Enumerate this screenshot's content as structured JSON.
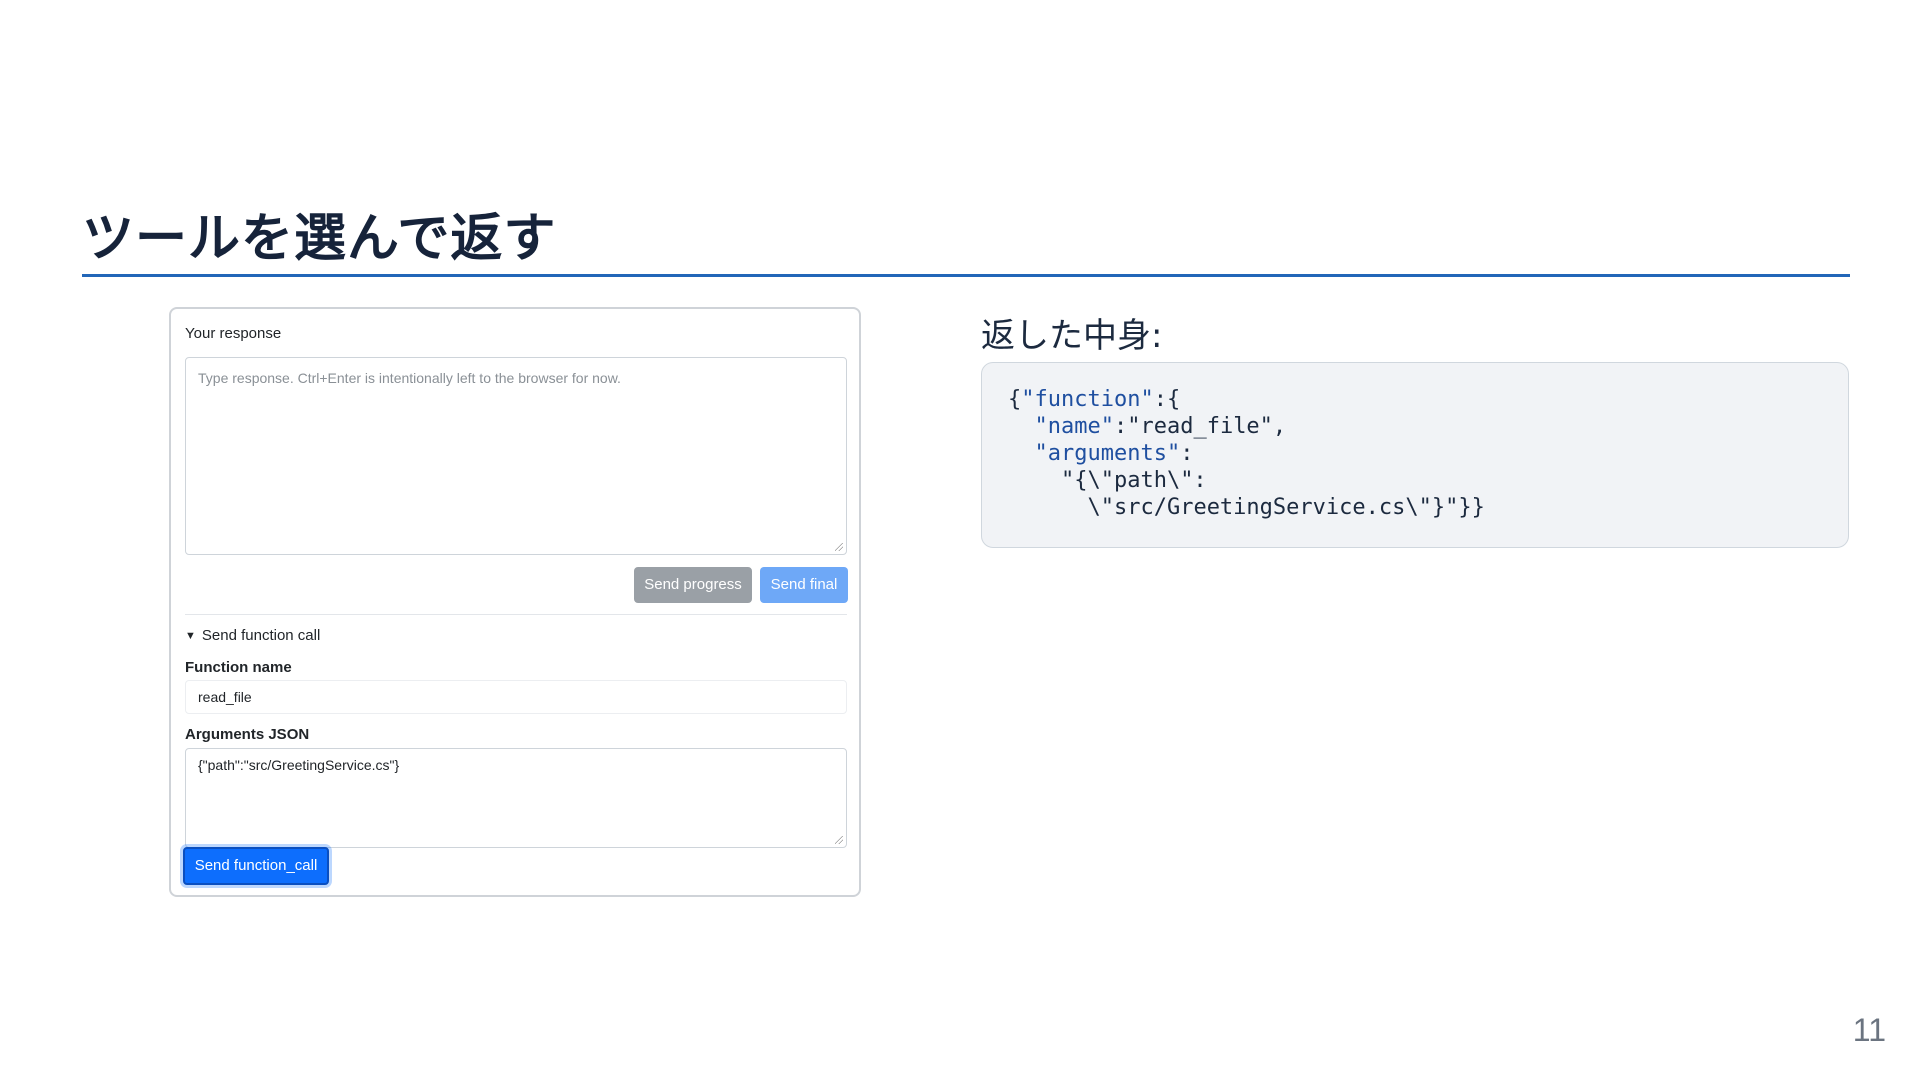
{
  "slide": {
    "title": "ツールを選んで返す",
    "subhead": "返した中身:",
    "page_number": "11"
  },
  "form": {
    "response_label": "Your response",
    "response_placeholder": "Type response. Ctrl+Enter is intentionally left to the browser for now.",
    "send_progress_label": "Send progress",
    "send_final_label": "Send final",
    "function_call_summary": "Send function call",
    "function_name_label": "Function name",
    "function_name_value": "read_file",
    "arguments_label": "Arguments JSON",
    "arguments_value": "{\"path\":\"src/GreetingService.cs\"}",
    "send_function_call_label": "Send function_call"
  },
  "code": {
    "line1_open": "{",
    "line1_key": "\"function\"",
    "line1_rest": ":{",
    "line2_key": "\"name\"",
    "line2_rest": ":\"read_file\",",
    "line3_key": "\"arguments\"",
    "line3_rest": ":",
    "line4": "\"{\\\"path\\\":",
    "line5": "\\\"src/GreetingService.cs\\\"}\"}}"
  },
  "colors": {
    "accent_rule": "#2266b8",
    "primary_button": "#0d6efd",
    "disabled_primary": "#6ea8f7",
    "secondary_button": "#9aa0a6",
    "code_key": "#1f4fa0"
  }
}
